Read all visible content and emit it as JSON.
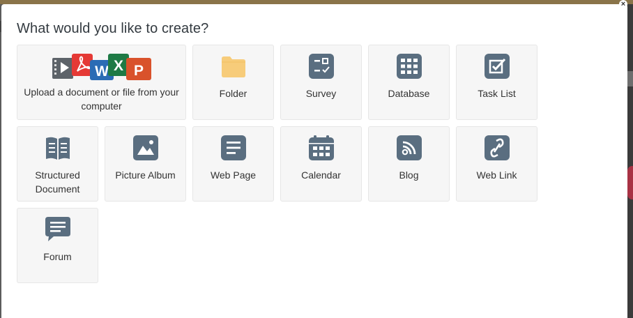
{
  "dialog": {
    "title": "What would you like to create?",
    "close_symbol": "×"
  },
  "items": [
    {
      "label": "Upload a document or file from your computer",
      "icon": "upload-file-icons"
    },
    {
      "label": "Folder",
      "icon": "folder-icon"
    },
    {
      "label": "Survey",
      "icon": "survey-icon"
    },
    {
      "label": "Database",
      "icon": "database-icon"
    },
    {
      "label": "Task List",
      "icon": "task-list-icon"
    },
    {
      "label": "Structured Document",
      "icon": "book-icon"
    },
    {
      "label": "Picture Album",
      "icon": "picture-icon"
    },
    {
      "label": "Web Page",
      "icon": "web-page-icon"
    },
    {
      "label": "Calendar",
      "icon": "calendar-icon"
    },
    {
      "label": "Blog",
      "icon": "rss-icon"
    },
    {
      "label": "Web Link",
      "icon": "link-icon"
    },
    {
      "label": "Forum",
      "icon": "forum-icon"
    }
  ],
  "upload_badges": {
    "word": "W",
    "excel": "X",
    "powerpoint": "P"
  },
  "colors": {
    "icon": "#5a6e80",
    "folder": "#f7cc7a",
    "tile_bg": "#f6f6f6",
    "pdf": "#e53935",
    "word": "#2b6cb5",
    "excel": "#1e7a45",
    "powerpoint": "#d9522b"
  }
}
